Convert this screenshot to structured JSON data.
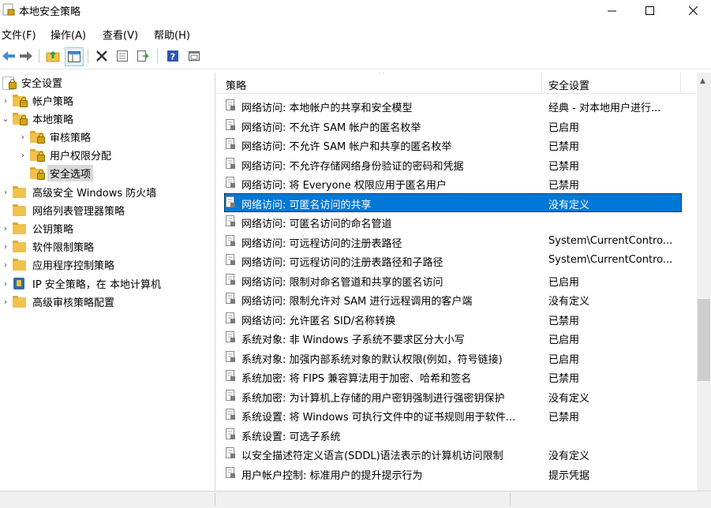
{
  "window": {
    "title": "本地安全策略"
  },
  "menu": [
    "文件(F)",
    "操作(A)",
    "查看(V)",
    "帮助(H)"
  ],
  "toolbar": {
    "buttons": [
      "back-icon",
      "forward-icon",
      "up-folder-icon",
      "show-hide-tree-icon",
      "delete-icon",
      "properties-icon",
      "export-list-icon",
      "help-icon",
      "view-icon"
    ]
  },
  "tree": {
    "root": "安全设置",
    "items": [
      {
        "label": "帐户策略"
      },
      {
        "label": "本地策略"
      },
      {
        "label": "审核策略"
      },
      {
        "label": "用户权限分配"
      },
      {
        "label": "安全选项"
      },
      {
        "label": "高级安全 Windows 防火墙"
      },
      {
        "label": "网络列表管理器策略"
      },
      {
        "label": "公钥策略"
      },
      {
        "label": "软件限制策略"
      },
      {
        "label": "应用程序控制策略"
      },
      {
        "label": "IP 安全策略，在 本地计算机"
      },
      {
        "label": "高级审核策略配置"
      }
    ]
  },
  "list": {
    "columns": {
      "policy": "策略",
      "setting": "安全设置"
    },
    "rows": [
      {
        "policy": "网络访问: 本地帐户的共享和安全模型",
        "setting": "经典 - 对本地用户进行..."
      },
      {
        "policy": "网络访问: 不允许 SAM 帐户的匿名枚举",
        "setting": "已启用"
      },
      {
        "policy": "网络访问: 不允许 SAM 帐户和共享的匿名枚举",
        "setting": "已禁用"
      },
      {
        "policy": "网络访问: 不允许存储网络身份验证的密码和凭据",
        "setting": "已禁用"
      },
      {
        "policy": "网络访问: 将 Everyone 权限应用于匿名用户",
        "setting": "已禁用"
      },
      {
        "policy": "网络访问: 可匿名访问的共享",
        "setting": "没有定义"
      },
      {
        "policy": "网络访问: 可匿名访问的命名管道",
        "setting": ""
      },
      {
        "policy": "网络访问: 可远程访问的注册表路径",
        "setting": "System\\CurrentContro..."
      },
      {
        "policy": "网络访问: 可远程访问的注册表路径和子路径",
        "setting": "System\\CurrentContro..."
      },
      {
        "policy": "网络访问: 限制对命名管道和共享的匿名访问",
        "setting": "已启用"
      },
      {
        "policy": "网络访问: 限制允许对 SAM 进行远程调用的客户端",
        "setting": "没有定义"
      },
      {
        "policy": "网络访问: 允许匿名 SID/名称转换",
        "setting": "已禁用"
      },
      {
        "policy": "系统对象: 非 Windows 子系统不要求区分大小写",
        "setting": "已启用"
      },
      {
        "policy": "系统对象: 加强内部系统对象的默认权限(例如，符号链接)",
        "setting": "已启用"
      },
      {
        "policy": "系统加密: 将 FIPS 兼容算法用于加密、哈希和签名",
        "setting": "已禁用"
      },
      {
        "policy": "系统加密: 为计算机上存储的用户密钥强制进行强密钥保护",
        "setting": "没有定义"
      },
      {
        "policy": "系统设置: 将 Windows 可执行文件中的证书规则用于软件...",
        "setting": "已禁用"
      },
      {
        "policy": "系统设置: 可选子系统",
        "setting": ""
      },
      {
        "policy": "以安全描述符定义语言(SDDL)语法表示的计算机访问限制",
        "setting": "没有定义"
      },
      {
        "policy": "用户帐户控制: 标准用户的提升提示行为",
        "setting": "提示凭据"
      }
    ],
    "selected_index": 5
  },
  "colors": {
    "selection": "#0078d7",
    "tree_selection": "#d9d9d9",
    "folder": "#f0c24d"
  }
}
